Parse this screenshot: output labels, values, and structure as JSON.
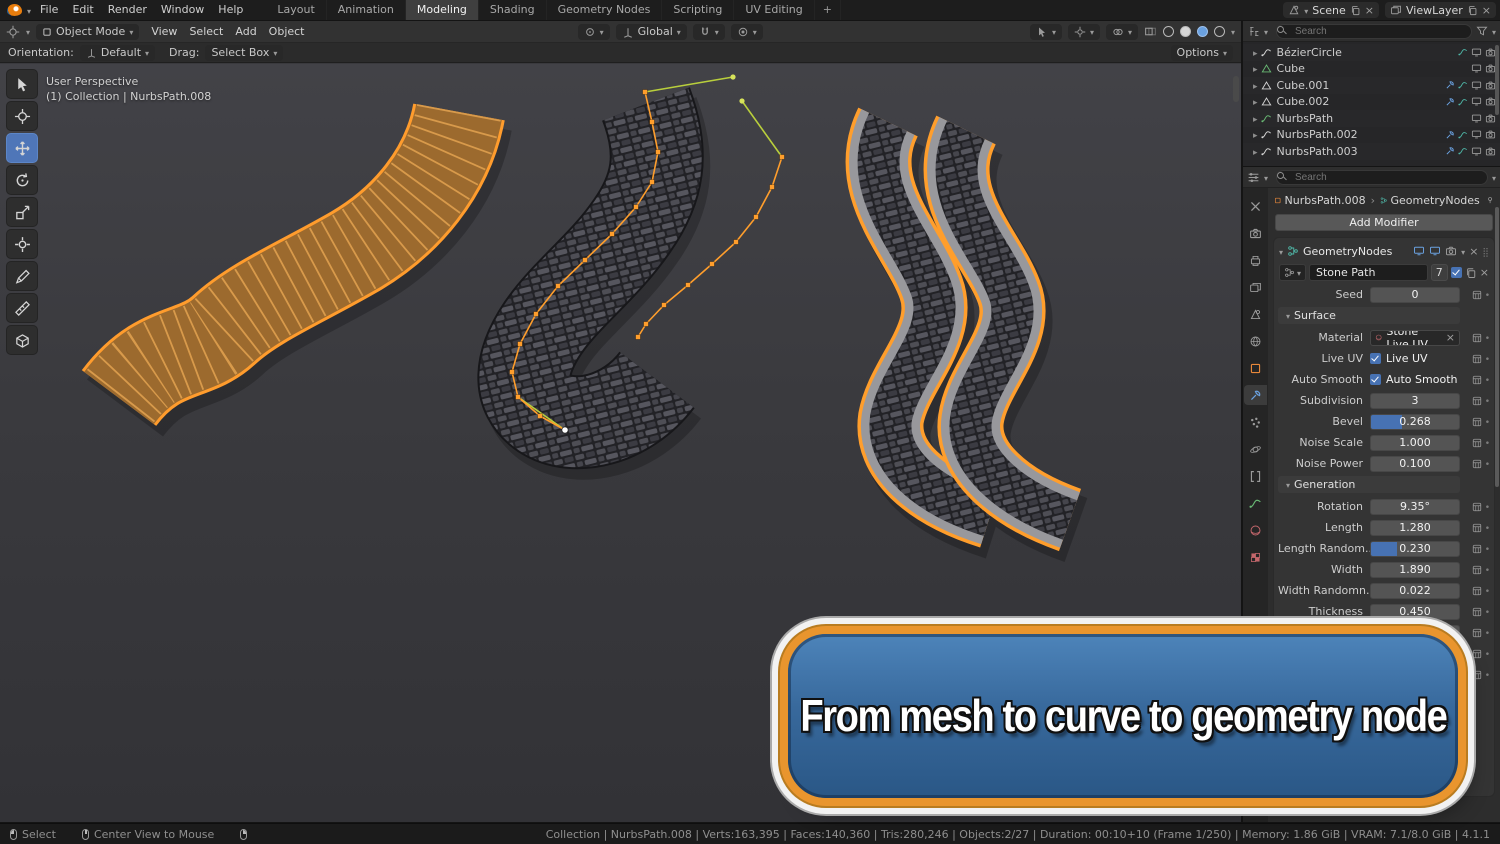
{
  "topbar": {
    "menus": [
      "File",
      "Edit",
      "Render",
      "Window",
      "Help"
    ],
    "workspaces": [
      "Layout",
      "Animation",
      "Modeling",
      "Shading",
      "Geometry Nodes",
      "Scripting",
      "UV Editing"
    ],
    "active_workspace": "Modeling",
    "new_workspace": "+",
    "scene": {
      "label": "Scene"
    },
    "viewlayer": {
      "label": "ViewLayer"
    }
  },
  "viewport_header": {
    "mode": "Object Mode",
    "menus": [
      "View",
      "Select",
      "Add",
      "Object"
    ],
    "orientation": "Global",
    "options_label": "Options"
  },
  "tool_settings": {
    "orientation_label": "Orientation:",
    "orientation_value": "Default",
    "drag_label": "Drag:",
    "drag_value": "Select Box"
  },
  "viewport": {
    "perspective_text": "User Perspective",
    "collection_text": "(1) Collection | NurbsPath.008"
  },
  "outliner": {
    "search_placeholder": "Search",
    "items": [
      {
        "name": "BézierCircle",
        "icon": "curve",
        "extras": [
          "curve-data"
        ]
      },
      {
        "name": "Cube",
        "icon": "mesh-green",
        "extras": []
      },
      {
        "name": "Cube.001",
        "icon": "mesh",
        "extras": [
          "wrench",
          "curve-data"
        ]
      },
      {
        "name": "Cube.002",
        "icon": "mesh",
        "extras": [
          "wrench",
          "curve-data"
        ]
      },
      {
        "name": "NurbsPath",
        "icon": "curve-green",
        "extras": []
      },
      {
        "name": "NurbsPath.002",
        "icon": "curve",
        "extras": [
          "wrench",
          "curve-data"
        ]
      },
      {
        "name": "NurbsPath.003",
        "icon": "curve",
        "extras": [
          "wrench",
          "curve-data"
        ]
      }
    ]
  },
  "properties": {
    "search_placeholder": "Search",
    "breadcrumb": {
      "object": "NurbsPath.008",
      "modifier": "GeometryNodes"
    },
    "add_modifier_label": "Add Modifier",
    "tabs": [
      "tool",
      "render",
      "output",
      "view-layer",
      "scene",
      "world",
      "object",
      "modifiers",
      "particles",
      "physics",
      "constraints",
      "object-data",
      "material",
      "texture"
    ],
    "active_tab": "modifiers",
    "modifier": {
      "name": "GeometryNodes",
      "node_group": "Stone Path",
      "users": "7",
      "rows": [
        {
          "type": "field",
          "label": "Seed",
          "value": "0"
        },
        {
          "type": "section",
          "label": "Surface"
        },
        {
          "type": "material",
          "label": "Material",
          "value": "Stone Live UV"
        },
        {
          "type": "check",
          "label": "Live UV",
          "checked": true
        },
        {
          "type": "check",
          "label": "Auto Smooth",
          "checked": true
        },
        {
          "type": "field",
          "label": "Subdivision",
          "value": "3"
        },
        {
          "type": "slider",
          "label": "Bevel",
          "value": "0.268",
          "fill": 0.35
        },
        {
          "type": "field",
          "label": "Noise Scale",
          "value": "1.000"
        },
        {
          "type": "field",
          "label": "Noise Power",
          "value": "0.100"
        },
        {
          "type": "section",
          "label": "Generation"
        },
        {
          "type": "field",
          "label": "Rotation",
          "value": "9.35°"
        },
        {
          "type": "field",
          "label": "Length",
          "value": "1.280"
        },
        {
          "type": "slider",
          "label": "Length Random...",
          "value": "0.230",
          "fill": 0.3
        },
        {
          "type": "field",
          "label": "Width",
          "value": "1.890"
        },
        {
          "type": "field",
          "label": "Width Randomn...",
          "value": "0.022"
        },
        {
          "type": "field",
          "label": "Thickness",
          "value": "0.450"
        },
        {
          "type": "deco-only"
        },
        {
          "type": "deco-only"
        },
        {
          "type": "deco-only"
        }
      ]
    }
  },
  "statusbar": {
    "left": [
      {
        "icon": "mouse-left",
        "label": "Select"
      },
      {
        "icon": "mouse-middle",
        "label": "Center View to Mouse"
      },
      {
        "icon": "mouse-right",
        "label": ""
      }
    ],
    "right": "Collection | NurbsPath.008 | Verts:163,395 | Faces:140,360 | Tris:280,246 | Objects:2/27 | Duration: 00:10+10 (Frame 1/250) | Memory: 1.86 GiB | VRAM: 7.1/8.0 GiB | 4.1.1"
  },
  "banner": {
    "text": "From mesh to curve to geometry node"
  },
  "colors": {
    "accent_blue": "#4772b3",
    "selection_orange": "#ff9e2c",
    "mesh_orange": "#a4732f",
    "curb_gray": "#98989c"
  }
}
